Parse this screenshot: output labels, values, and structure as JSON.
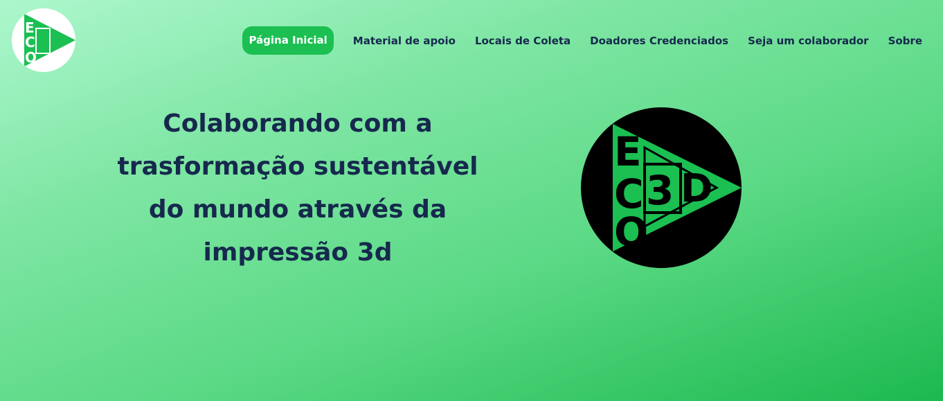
{
  "header": {
    "logo_text": "ECO3D",
    "nav": [
      {
        "label": "Página Inicial"
      },
      {
        "label": "Material de apoio"
      },
      {
        "label": "Locais de Coleta"
      },
      {
        "label": "Doadores Credenciados"
      },
      {
        "label": "Seja um colaborador"
      },
      {
        "label": "Sobre"
      }
    ]
  },
  "hero": {
    "title": "Colaborando com a trasformação sustentável do mundo através da impressão 3d",
    "logo_text": "ECO3D"
  },
  "colors": {
    "brand_green": "#1bbf52",
    "text_navy": "#16294d",
    "gradient_start": "#adf7cd",
    "gradient_end": "#1cb94f"
  }
}
